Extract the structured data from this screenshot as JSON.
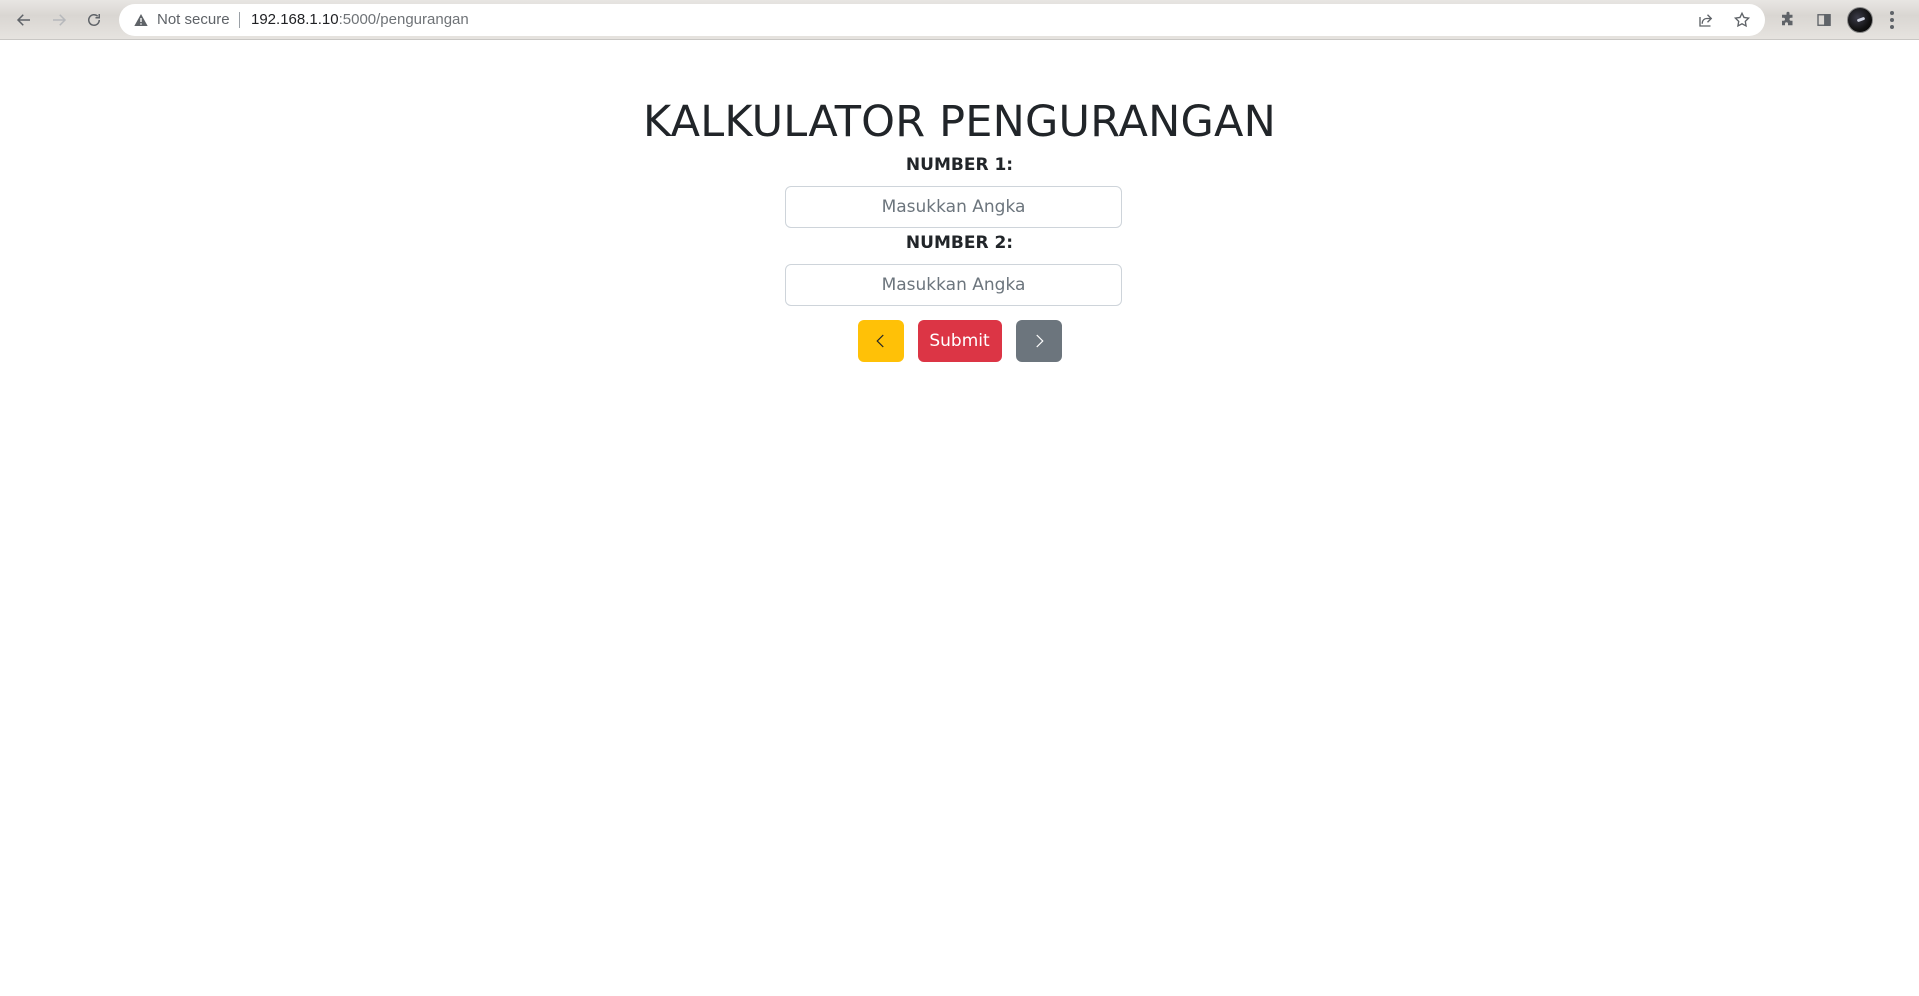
{
  "browser": {
    "security_text": "Not secure",
    "url_host": "192.168.1.10",
    "url_rest": ":5000/pengurangan",
    "icons": [
      "back-icon",
      "forward-icon",
      "reload-icon",
      "warning-icon",
      "share-icon",
      "star-icon",
      "extensions-icon",
      "side-panel-icon",
      "profile-avatar",
      "menu-icon"
    ]
  },
  "page": {
    "title": "KALKULATOR PENGURANGAN",
    "fields": [
      {
        "label": "NUMBER 1:",
        "placeholder": "Masukkan Angka",
        "value": ""
      },
      {
        "label": "NUMBER 2:",
        "placeholder": "Masukkan Angka",
        "value": ""
      }
    ],
    "buttons": {
      "prev_icon": "chevron-left-icon",
      "submit_label": "Submit",
      "next_icon": "chevron-right-icon"
    }
  },
  "colors": {
    "prev_button": "#ffc107",
    "submit_button": "#dc3545",
    "next_button": "#6c757d",
    "text": "#212529"
  }
}
